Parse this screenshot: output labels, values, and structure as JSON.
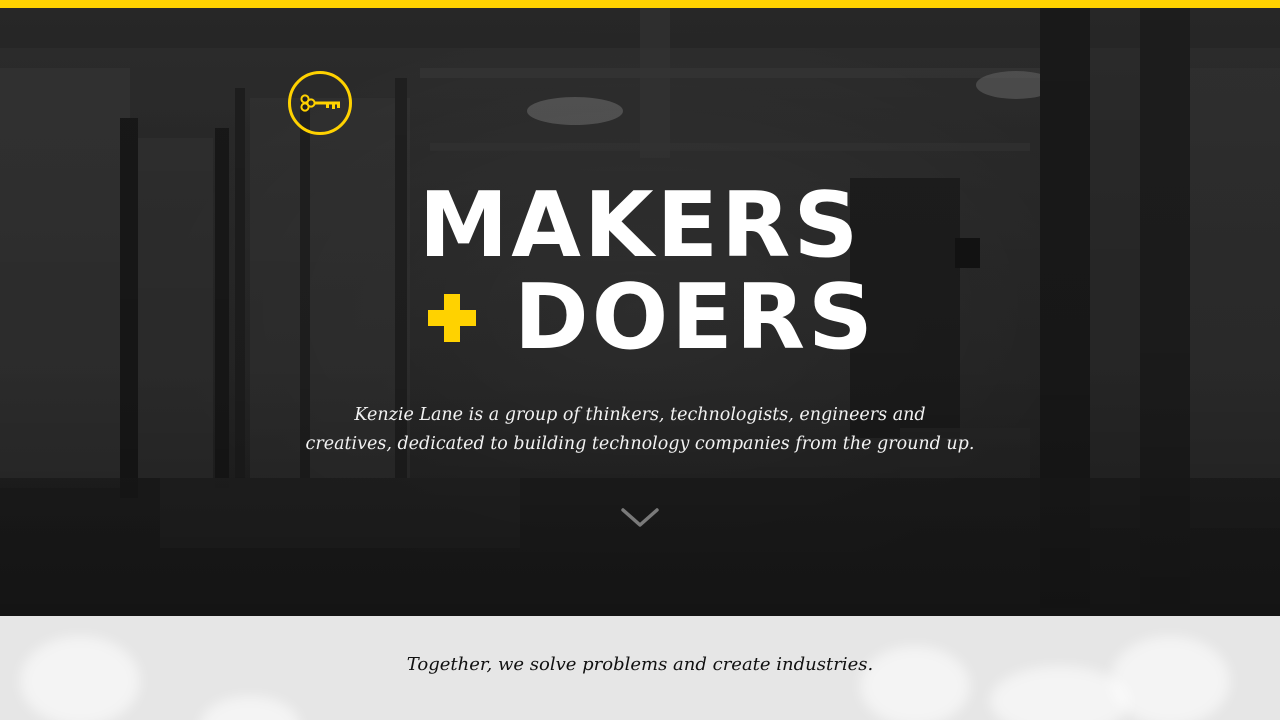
{
  "brand": {
    "logo_icon": "key-icon",
    "accent_color": "#ffd200"
  },
  "hero": {
    "headline_line1": "MAKERS",
    "headline_line2": "DOERS",
    "plus_icon": "plus-icon",
    "tagline_line1": "Kenzie Lane is a group of thinkers, technologists, engineers and",
    "tagline_line2": "creatives, dedicated to building technology companies from the ground up.",
    "scroll_icon": "chevron-down-icon"
  },
  "intro": {
    "text": "Together, we solve problems and create industries."
  }
}
